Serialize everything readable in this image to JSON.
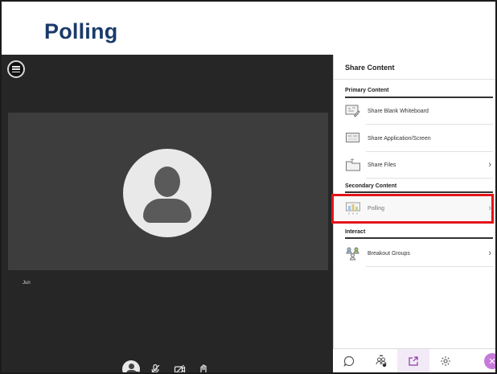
{
  "slide": {
    "title": "Polling"
  },
  "stage": {
    "participant_name": "Jun",
    "controls": [
      "my-status-avatar",
      "mic-off-icon",
      "camera-off-icon",
      "raise-hand-icon"
    ]
  },
  "panel": {
    "title": "Share Content",
    "primary": {
      "label": "Primary Content",
      "items": [
        {
          "label": "Share Blank Whiteboard",
          "icon": "whiteboard-icon",
          "has_chevron": false
        },
        {
          "label": "Share Application/Screen",
          "icon": "screen-share-icon",
          "has_chevron": false
        },
        {
          "label": "Share Files",
          "icon": "folder-icon",
          "has_chevron": true
        }
      ]
    },
    "secondary": {
      "label": "Secondary Content",
      "items": [
        {
          "label": "Polling",
          "icon": "polling-icon",
          "has_chevron": true,
          "highlighted": true
        }
      ]
    },
    "interact": {
      "label": "Interact",
      "items": [
        {
          "label": "Breakout Groups",
          "icon": "breakout-groups-icon",
          "has_chevron": true
        }
      ]
    }
  },
  "bottom_tabs": [
    "chat-icon",
    "attendees-icon",
    "share-content-icon",
    "settings-icon",
    "close-panel-icon"
  ],
  "colors": {
    "highlight": "#e3141b",
    "title": "#1a3a6b",
    "accent": "#8a3aa5"
  }
}
